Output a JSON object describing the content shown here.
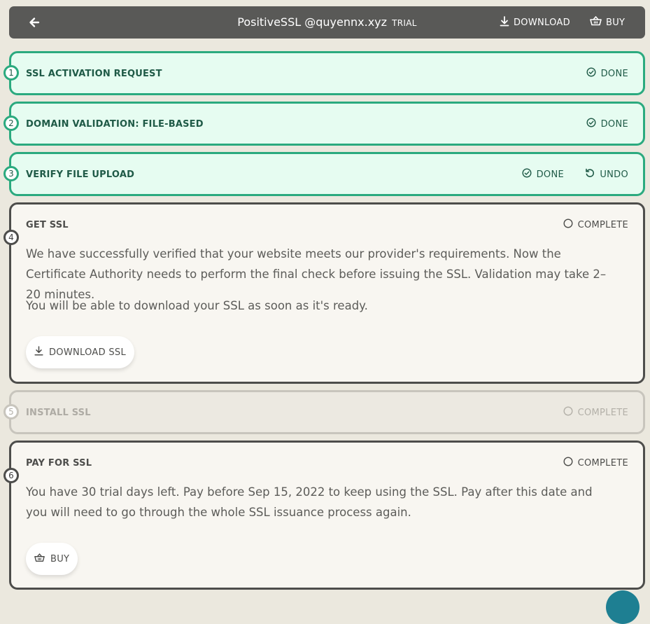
{
  "header": {
    "title": "PositiveSSL @quyennx.xyz",
    "tag": "TRIAL",
    "download_label": "DOWNLOAD",
    "buy_label": "BUY",
    "icons": [
      "arrow-left-icon",
      "download-icon",
      "basket-icon"
    ]
  },
  "steps": [
    {
      "number": "1",
      "title": "SSL ACTIVATION REQUEST",
      "status": "DONE"
    },
    {
      "number": "2",
      "title": "DOMAIN VALIDATION: FILE-BASED",
      "status": "DONE"
    },
    {
      "number": "3",
      "title": "VERIFY FILE UPLOAD",
      "status": "DONE",
      "undo_label": "UNDO"
    },
    {
      "number": "4",
      "title": "GET SSL",
      "status": "COMPLETE",
      "paragraph1": "We have successfully verified that your website meets our provider's requirements. Now the Certificate Authority needs to perform the final check before issuing the SSL. Validation may take 2–20 minutes.",
      "paragraph2": "You will be able to download your SSL as soon as it's ready.",
      "button_label": "DOWNLOAD SSL"
    },
    {
      "number": "5",
      "title": "INSTALL SSL",
      "status": "COMPLETE"
    },
    {
      "number": "6",
      "title": "PAY FOR SSL",
      "status": "COMPLETE",
      "paragraph1": "You have 30 trial days left. Pay before Sep 15, 2022 to keep using the SSL. Pay after this date and you will need to go through the whole SSL issuance process again.",
      "button_label": "BUY"
    }
  ],
  "colors": {
    "background": "#ebe8de",
    "header": "#595957",
    "done_fill": "#e6fcf1",
    "done_border": "#2baa7f",
    "active_border": "#4d4d4b",
    "disabled_border": "#c8c5bd"
  }
}
